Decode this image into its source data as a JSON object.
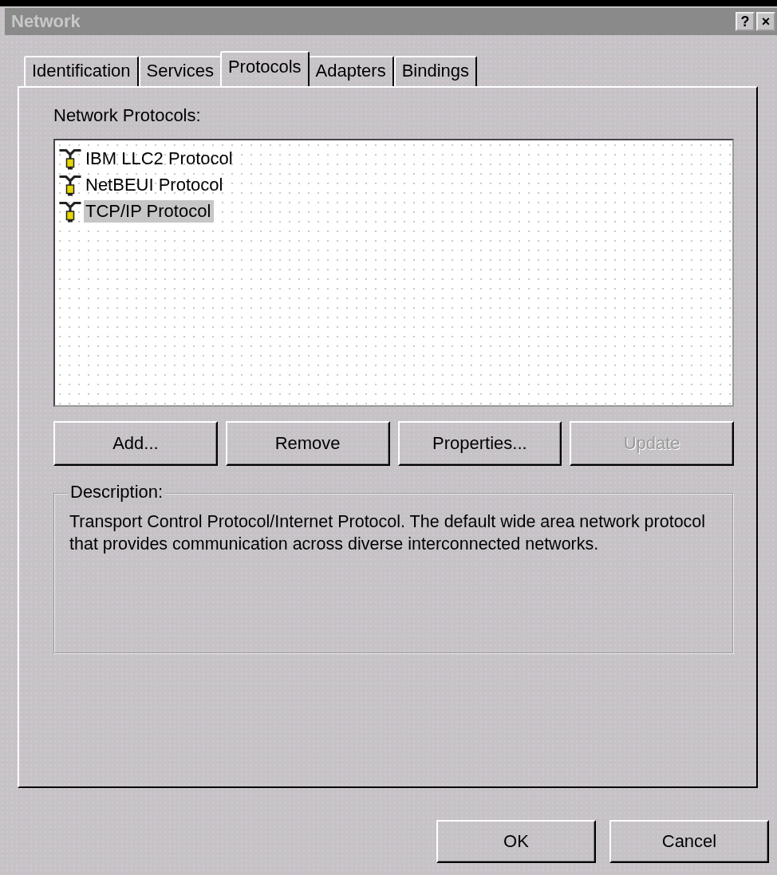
{
  "window": {
    "title": "Network",
    "title_buttons": [
      "?",
      "×"
    ]
  },
  "tabs": [
    {
      "label": "Identification",
      "selected": false
    },
    {
      "label": "Services",
      "selected": false
    },
    {
      "label": "Protocols",
      "selected": true
    },
    {
      "label": "Adapters",
      "selected": false
    },
    {
      "label": "Bindings",
      "selected": false
    }
  ],
  "protocols": {
    "label": "Network Protocols:",
    "items": [
      {
        "name": "IBM LLC2 Protocol",
        "selected": false
      },
      {
        "name": "NetBEUI Protocol",
        "selected": false
      },
      {
        "name": "TCP/IP Protocol",
        "selected": true
      }
    ]
  },
  "buttons": [
    {
      "label": "Add...",
      "disabled": false
    },
    {
      "label": "Remove",
      "disabled": false
    },
    {
      "label": "Properties...",
      "disabled": false
    },
    {
      "label": "Update",
      "disabled": true
    }
  ],
  "description": {
    "label": "Description:",
    "text": "Transport Control Protocol/Internet Protocol. The default wide area network protocol that provides communication across diverse interconnected networks."
  },
  "dialog_buttons": [
    "OK",
    "Cancel"
  ]
}
